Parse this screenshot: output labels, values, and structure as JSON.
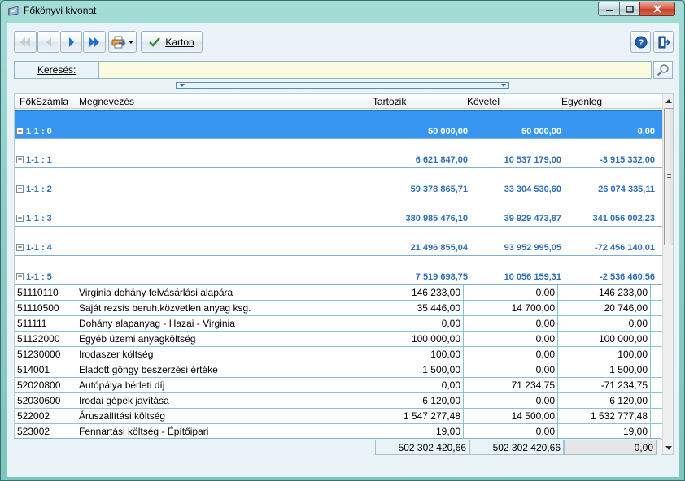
{
  "window": {
    "title": "Főkönyvi kivonat"
  },
  "toolbar": {
    "karton_label": "Karton"
  },
  "search": {
    "label": "Keresés:",
    "value": ""
  },
  "columns": [
    "FőkSzámla",
    "Megnevezés",
    "Tartozik",
    "Követel",
    "Egyenleg"
  ],
  "groups": [
    {
      "name": "1-1 : 0",
      "tartozik": "50 000,00",
      "kovetel": "50 000,00",
      "egyenleg": "0,00",
      "selected": true,
      "expanded": false
    },
    {
      "name": "1-1 : 1",
      "tartozik": "6 621 847,00",
      "kovetel": "10 537 179,00",
      "egyenleg": "-3 915 332,00",
      "selected": false,
      "expanded": false
    },
    {
      "name": "1-1 : 2",
      "tartozik": "59 378 865,71",
      "kovetel": "33 304 530,60",
      "egyenleg": "26 074 335,11",
      "selected": false,
      "expanded": false
    },
    {
      "name": "1-1 : 3",
      "tartozik": "380 985 476,10",
      "kovetel": "39 929 473,87",
      "egyenleg": "341 056 002,23",
      "selected": false,
      "expanded": false
    },
    {
      "name": "1-1 : 4",
      "tartozik": "21 496 855,04",
      "kovetel": "93 952 995,05",
      "egyenleg": "-72 456 140,01",
      "selected": false,
      "expanded": false
    },
    {
      "name": "1-1 : 5",
      "tartozik": "7 519 698,75",
      "kovetel": "10 056 159,31",
      "egyenleg": "-2 536 460,56",
      "selected": false,
      "expanded": true
    }
  ],
  "rows": [
    {
      "szamla": "51110110",
      "nev": "Virginia dohány felvásárlási alapára",
      "tartozik": "146 233,00",
      "kovetel": "0,00",
      "egyenleg": "146 233,00"
    },
    {
      "szamla": "51110500",
      "nev": "Saját rezsis beruh.közvetlen anyag ksg.",
      "tartozik": "35 446,00",
      "kovetel": "14 700,00",
      "egyenleg": "20 746,00"
    },
    {
      "szamla": "511111",
      "nev": "Dohány alapanyag - Hazai - Virginia",
      "tartozik": "0,00",
      "kovetel": "0,00",
      "egyenleg": "0,00"
    },
    {
      "szamla": "51122000",
      "nev": "Egyéb üzemi anyagköltség",
      "tartozik": "100 000,00",
      "kovetel": "0,00",
      "egyenleg": "100 000,00"
    },
    {
      "szamla": "51230000",
      "nev": "Irodaszer költség",
      "tartozik": "100,00",
      "kovetel": "0,00",
      "egyenleg": "100,00"
    },
    {
      "szamla": "514001",
      "nev": "Eladott göngy beszerzési értéke",
      "tartozik": "1 500,00",
      "kovetel": "0,00",
      "egyenleg": "1 500,00"
    },
    {
      "szamla": "52020800",
      "nev": "Autópálya bérleti díj",
      "tartozik": "0,00",
      "kovetel": "71 234,75",
      "egyenleg": "-71 234,75"
    },
    {
      "szamla": "52030600",
      "nev": "Irodai gépek javítása",
      "tartozik": "6 120,00",
      "kovetel": "0,00",
      "egyenleg": "6 120,00"
    },
    {
      "szamla": "522002",
      "nev": "Áruszállítási költség",
      "tartozik": "1 547 277,48",
      "kovetel": "14 500,00",
      "egyenleg": "1 532 777,48"
    },
    {
      "szamla": "523002",
      "nev": "Fennartási költség - Építőipari",
      "tartozik": "19,00",
      "kovetel": "0,00",
      "egyenleg": "19,00"
    }
  ],
  "totals": {
    "tartozik": "502 302 420,66",
    "kovetel": "502 302 420,66",
    "egyenleg": "0,00"
  },
  "colors": {
    "selected_row": "#3797f0",
    "group_text": "#2f6eb8",
    "search_bg": "#fbfbdf",
    "accent_blue": "#1f6fd1"
  }
}
